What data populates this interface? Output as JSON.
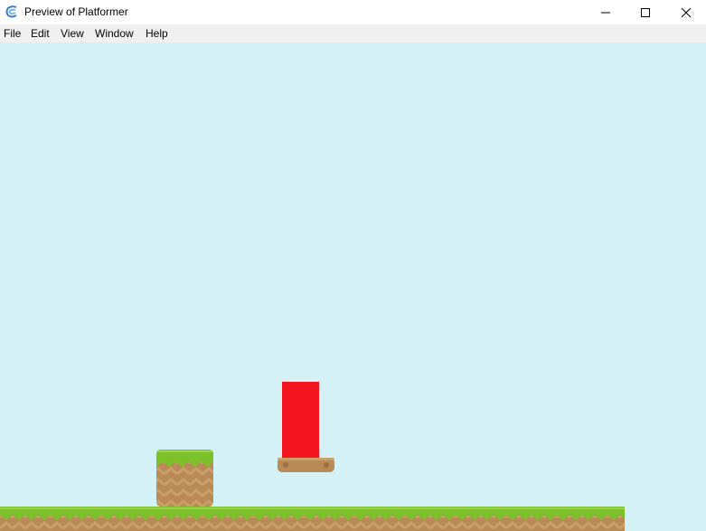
{
  "window": {
    "title": "Preview of Platformer",
    "icon": "gdevelop-logo-icon",
    "controls": [
      "minimize-icon",
      "maximize-icon",
      "close-icon"
    ]
  },
  "menu": {
    "file": "File",
    "edit": "Edit",
    "view": "View",
    "window": "Window",
    "help": "Help"
  },
  "scene": {
    "background_color": "#d4f2f5",
    "objects": [
      {
        "name": "player",
        "shape": "red-rectangle",
        "color": "#f2141e"
      },
      {
        "name": "moving-platform",
        "shape": "wooden-platform",
        "color": "#b98a56"
      },
      {
        "name": "grass-block",
        "shape": "grass-dirt-block",
        "color": "#7cc02a"
      },
      {
        "name": "ground-strip",
        "shape": "grass-dirt-ground",
        "color": "#7cc02a"
      }
    ]
  }
}
